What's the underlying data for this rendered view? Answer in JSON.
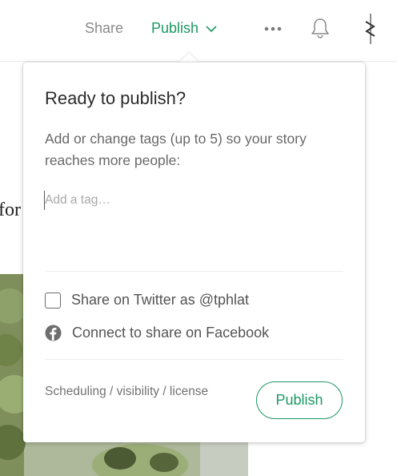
{
  "header": {
    "share_label": "Share",
    "publish_label": "Publish",
    "accent_color": "#1c9963"
  },
  "background": {
    "article_fragment": "for"
  },
  "publish_dialog": {
    "title": "Ready to publish?",
    "description": "Add or change tags (up to 5) so your story reaches more people:",
    "tag_input": {
      "placeholder": "Add a tag…",
      "value": ""
    },
    "twitter_option": {
      "label": "Share on Twitter as @tphlat",
      "checked": false
    },
    "facebook_option": {
      "label": "Connect to share on Facebook"
    },
    "footer_link": "Scheduling / visibility / license",
    "publish_button": "Publish"
  }
}
